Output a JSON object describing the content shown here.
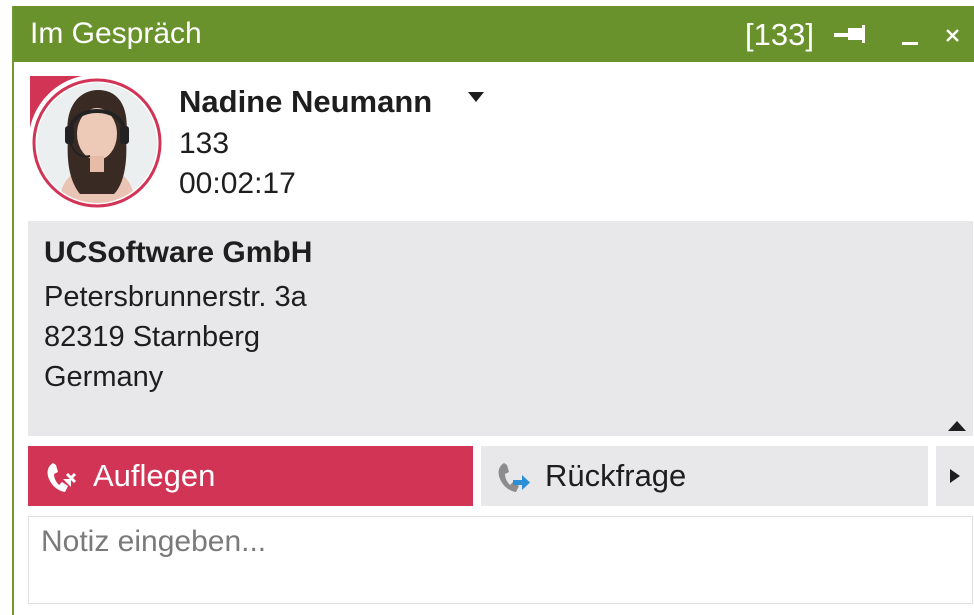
{
  "window": {
    "title": "Im Gespräch",
    "extension_badge": "[133]",
    "icons": {
      "pin": "pin-icon",
      "minimize": "minimize-icon",
      "close": "close-icon"
    }
  },
  "contact": {
    "name": "Nadine Neumann",
    "number": "133",
    "duration": "00:02:17",
    "avatar_icon": "contact-avatar-photo"
  },
  "company": {
    "name": "UCSoftware GmbH",
    "street": "Petersbrunnerstr. 3a",
    "city": "82319 Starnberg",
    "country": "Germany"
  },
  "actions": {
    "hangup_label": "Auflegen",
    "consult_label": "Rückfrage"
  },
  "note": {
    "placeholder": "Notiz eingeben..."
  },
  "colors": {
    "titlebar": "#6a922c",
    "hangup": "#d23456",
    "panel": "#e8e8ea",
    "consult_icon_accent": "#2a8fd6"
  }
}
